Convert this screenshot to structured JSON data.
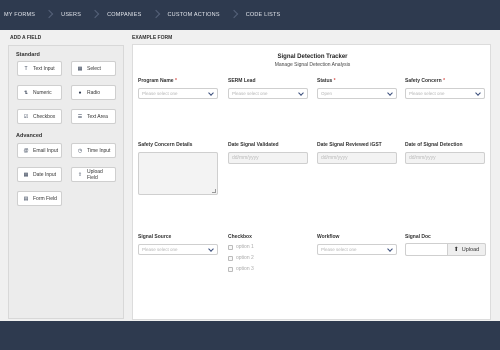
{
  "nav": {
    "items": [
      "MY FORMS",
      "USERS",
      "COMPANIES",
      "CUSTOM ACTIONS",
      "CODE LISTS"
    ]
  },
  "left": {
    "title": "ADD A FIELD",
    "standard_label": "Standard",
    "advanced_label": "Advanced",
    "standard": [
      {
        "label": "Text Input",
        "icon": "text-input-icon"
      },
      {
        "label": "Select",
        "icon": "select-icon"
      },
      {
        "label": "Numeric",
        "icon": "numeric-icon"
      },
      {
        "label": "Radio",
        "icon": "radio-icon"
      },
      {
        "label": "Checkbox",
        "icon": "checkbox-icon"
      },
      {
        "label": "Text Area",
        "icon": "text-area-icon"
      }
    ],
    "advanced": [
      {
        "label": "Email Input",
        "icon": "email-icon"
      },
      {
        "label": "Time Input",
        "icon": "clock-icon"
      },
      {
        "label": "Date Input",
        "icon": "calendar-icon"
      },
      {
        "label": "Upload Field",
        "icon": "upload-icon"
      },
      {
        "label": "Form Field",
        "icon": "form-icon"
      }
    ]
  },
  "form": {
    "section_title": "EXAMPLE FORM",
    "title": "Signal Detection Tracker",
    "subtitle": "Manage Signal Detection Analysis",
    "fields": {
      "program_name": {
        "label": "Program Name",
        "required": "*",
        "placeholder": "Please select one"
      },
      "serm_lead": {
        "label": "SERM Lead",
        "placeholder": "Please select one"
      },
      "status": {
        "label": "Status",
        "required": "*",
        "placeholder": "Open"
      },
      "safety_concern": {
        "label": "Safety Concern",
        "required": "*",
        "placeholder": "Please select one"
      },
      "safety_concern_details": {
        "label": "Safety Concern Details"
      },
      "date_signal_validated": {
        "label": "Date Signal Validated",
        "placeholder": "dd/mm/yyyy"
      },
      "date_signal_reviewed": {
        "label": "Date Signal Reviewed iGST",
        "placeholder": "dd/mm/yyyy"
      },
      "date_signal_detection": {
        "label": "Date of Signal Detection",
        "placeholder": "dd/mm/yyyy"
      },
      "signal_source": {
        "label": "Signal Source",
        "placeholder": "Please select one"
      },
      "checkbox": {
        "label": "Checkbox",
        "options": [
          "option 1",
          "option 2",
          "option 3"
        ]
      },
      "workflow": {
        "label": "Workflow",
        "placeholder": "Please select one"
      },
      "signal_doc": {
        "label": "Signal Doc",
        "button": "Upload"
      }
    }
  },
  "colors": {
    "nav_bg": "#2e3a4f",
    "required": "#d9534f"
  }
}
